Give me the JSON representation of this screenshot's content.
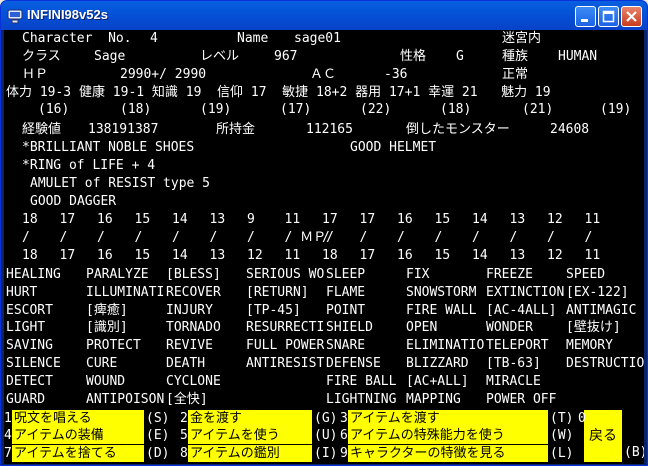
{
  "window": {
    "title": "INFINI98v52s"
  },
  "status": {
    "row1": {
      "character_label": "Character  No.",
      "character_no": "4",
      "name_label": "Name",
      "name": "sage01",
      "location": "迷宮内"
    },
    "row2": {
      "class_label": "クラス",
      "class_value": "Sage",
      "level_label": "レベル",
      "level": "967",
      "personality_label": "性格",
      "personality": "G",
      "race_label": "種族",
      "race": "HUMAN"
    },
    "row3": {
      "hp_label": "ＨＰ",
      "hp": "2990+/ 2990",
      "ac_label": "ＡＣ",
      "ac": "-36",
      "condition": "正常"
    },
    "stats_line": "体力 19-3 健康 19-1 知識 19  信仰 17  敏捷 18+2 器用 17+1 幸運 21   魅力 19",
    "stats_sub": [
      "(16)",
      "(18)",
      "(19)",
      "(17)",
      "(22)",
      "(18)",
      "(21)",
      "(19)"
    ],
    "exp_label": "経験値",
    "exp": "138191387",
    "gold_label": "所持金",
    "gold": "112165",
    "kills_label": "倒したモンスター",
    "kills": "24608"
  },
  "equipment": [
    "*BRILLIANT NOBLE SHOES",
    "GOOD HELMET",
    "*RING of LIFE + 4",
    "AMULET of RESIST type 5",
    "GOOD DAGGER"
  ],
  "mp": {
    "row_top": [
      "18",
      "17",
      "16",
      "15",
      "14",
      "13",
      "9",
      "11",
      "17",
      "17",
      "16",
      "15",
      "14",
      "13",
      "12",
      "11"
    ],
    "slashes": [
      "/",
      "/",
      "/",
      "/",
      "/",
      "/",
      "/",
      "/ ＭＰ/",
      "/",
      "/",
      "/",
      "/",
      "/",
      "/",
      "/",
      "/"
    ],
    "row_bottom": [
      "18",
      "17",
      "16",
      "15",
      "14",
      "13",
      "12",
      "11",
      "18",
      "17",
      "16",
      "15",
      "14",
      "13",
      "12",
      "11"
    ]
  },
  "spells": [
    [
      "HEALING",
      "PARALYZE",
      "[BLESS]",
      "SERIOUS WO",
      "SLEEP",
      "FIX",
      "FREEZE",
      "SPEED"
    ],
    [
      "HURT",
      "ILLUMINATI",
      "RECOVER",
      "[RETURN]",
      "FLAME",
      "SNOWSTORM",
      "EXTINCTION",
      "[EX-122]"
    ],
    [
      "ESCORT",
      "[痺癒]",
      "INJURY",
      "[TP-45]",
      "POINT",
      "FIRE WALL",
      "[AC-4ALL]",
      "ANTIMAGIC"
    ],
    [
      "LIGHT",
      "[識別]",
      "TORNADO",
      "RESURRECTI",
      "SHIELD",
      "OPEN",
      "WONDER",
      "[壁抜け]"
    ],
    [
      "SAVING",
      "PROTECT",
      "REVIVE",
      "FULL POWER",
      "SNARE",
      "ELIMINATIO",
      "TELEPORT",
      "MEMORY"
    ],
    [
      "SILENCE",
      "CURE",
      "DEATH",
      "ANTIRESIST",
      "DEFENSE",
      "BLIZZARD",
      "[TB-63]",
      "DESTRUCTIO"
    ],
    [
      "DETECT",
      "WOUND",
      "CYCLONE",
      "",
      "FIRE BALL",
      "[AC+ALL]",
      "MIRACLE",
      ""
    ],
    [
      "GUARD",
      "ANTIPOISON",
      "[全快]",
      "",
      "LIGHTNING",
      "MAPPING",
      "POWER OFF",
      ""
    ]
  ],
  "menu": [
    {
      "num": "1",
      "label": "呪文を唱える",
      "key": "(S)"
    },
    {
      "num": "2",
      "label": "金を渡す",
      "key": "(G)"
    },
    {
      "num": "3",
      "label": "アイテムを渡す",
      "key": "(T)"
    },
    {
      "num": "4",
      "label": "アイテムの装備",
      "key": "(E)"
    },
    {
      "num": "5",
      "label": "アイテムを使う",
      "key": "(U)"
    },
    {
      "num": "6",
      "label": "アイテムの特殊能力を使う",
      "key": "(W)"
    },
    {
      "num": "7",
      "label": "アイテムを捨てる",
      "key": "(D)"
    },
    {
      "num": "8",
      "label": "アイテムの鑑別",
      "key": "(I)"
    },
    {
      "num": "9",
      "label": "キャラクターの特徴を見る",
      "key": "(L)"
    }
  ],
  "back": {
    "num": "0",
    "label": "戻る",
    "key": "(B)"
  }
}
